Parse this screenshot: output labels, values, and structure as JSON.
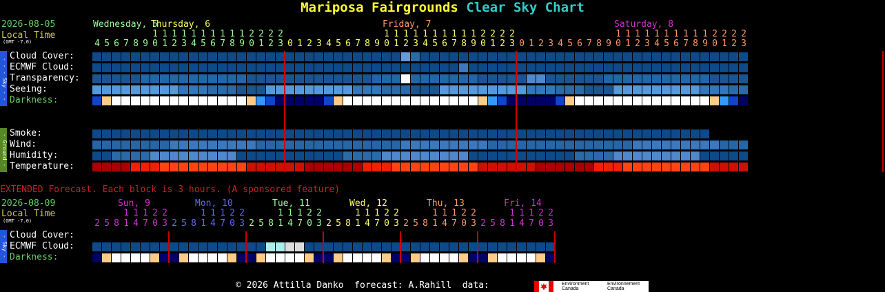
{
  "title": {
    "location": "Mariposa Fairgrounds",
    "chart": "Clear Sky Chart"
  },
  "main": {
    "date": "2026-08-05",
    "local_time": "Local Time",
    "gmt": "(GMT -7.0)",
    "days": [
      {
        "label": "Wednesday, 5",
        "color": "#99ff99"
      },
      {
        "label": "Thursday, 6",
        "color": "#ffff66"
      },
      {
        "label": "Friday, 7",
        "color": "#ff9966"
      },
      {
        "label": "Saturday, 8",
        "color": "#cc33cc"
      }
    ],
    "sky_sidebar": "- - - Sky - - -",
    "ground_sidebar": "- Ground -",
    "rows": {
      "cloud": "Cloud Cover:",
      "ecmwf": "ECMWF Cloud:",
      "transparency": "Transparency:",
      "seeing": "Seeing:",
      "darkness": "Darkness:",
      "smoke": "Smoke:",
      "wind": "Wind:",
      "humidity": "Humidity:",
      "temperature": "Temperature:"
    },
    "hour_start": 4,
    "hour_count": 68,
    "smoke_count": 64,
    "special_cells": {
      "cloud": [
        {
          "i": 32,
          "color": "#6699dd"
        },
        {
          "i": 33,
          "color": "#2a6aa8"
        }
      ],
      "ecmwf": [
        {
          "i": 38,
          "color": "#3a78c0"
        }
      ],
      "transparency": [
        {
          "i": 32,
          "color": "#ffffff"
        },
        {
          "i": 45,
          "color": "#4f88cc"
        },
        {
          "i": 46,
          "color": "#4f88cc"
        }
      ]
    }
  },
  "extended": {
    "note": "EXTENDED Forecast. Each block is 3 hours. (A sponsored feature)",
    "date": "2026-08-09",
    "local_time": "Local Time",
    "gmt": "(GMT -7.0)",
    "days": [
      {
        "label": "Sun, 9",
        "color": "#cc33cc"
      },
      {
        "label": "Mon, 10",
        "color": "#6666ff"
      },
      {
        "label": "Tue, 11",
        "color": "#99ff99"
      },
      {
        "label": "Wed, 12",
        "color": "#ffff66"
      },
      {
        "label": "Thu, 13",
        "color": "#ff9966"
      },
      {
        "label": "Fri, 14",
        "color": "#cc33cc"
      }
    ],
    "sky_sidebar": "- Sky -",
    "rows": {
      "cloud": "Cloud Cover:",
      "ecmwf": "ECMWF Cloud:",
      "darkness": "Darkness:"
    },
    "block_hours": [
      2,
      5,
      8,
      11,
      14,
      17,
      20,
      23
    ],
    "ecmwf_special": [
      {
        "i": 18,
        "color": "#aaeeee"
      },
      {
        "i": 19,
        "color": "#aaeeee"
      },
      {
        "i": 20,
        "color": "#dddddd"
      },
      {
        "i": 21,
        "color": "#dddddd"
      }
    ]
  },
  "colors": {
    "date_green": "#66cc66",
    "local_time_yellow": "#cccc33",
    "cloud_dark": "#0d4a8a",
    "blue_mid": "#2266aa",
    "blue_light": "#5599dd",
    "vline": "#cc0000"
  },
  "footer": {
    "credit": "© 2026 Attilla Danko  forecast: A.Rahill  data:",
    "logo_en": "Environment\nCanada",
    "logo_fr": "Environnement\nCanada"
  }
}
